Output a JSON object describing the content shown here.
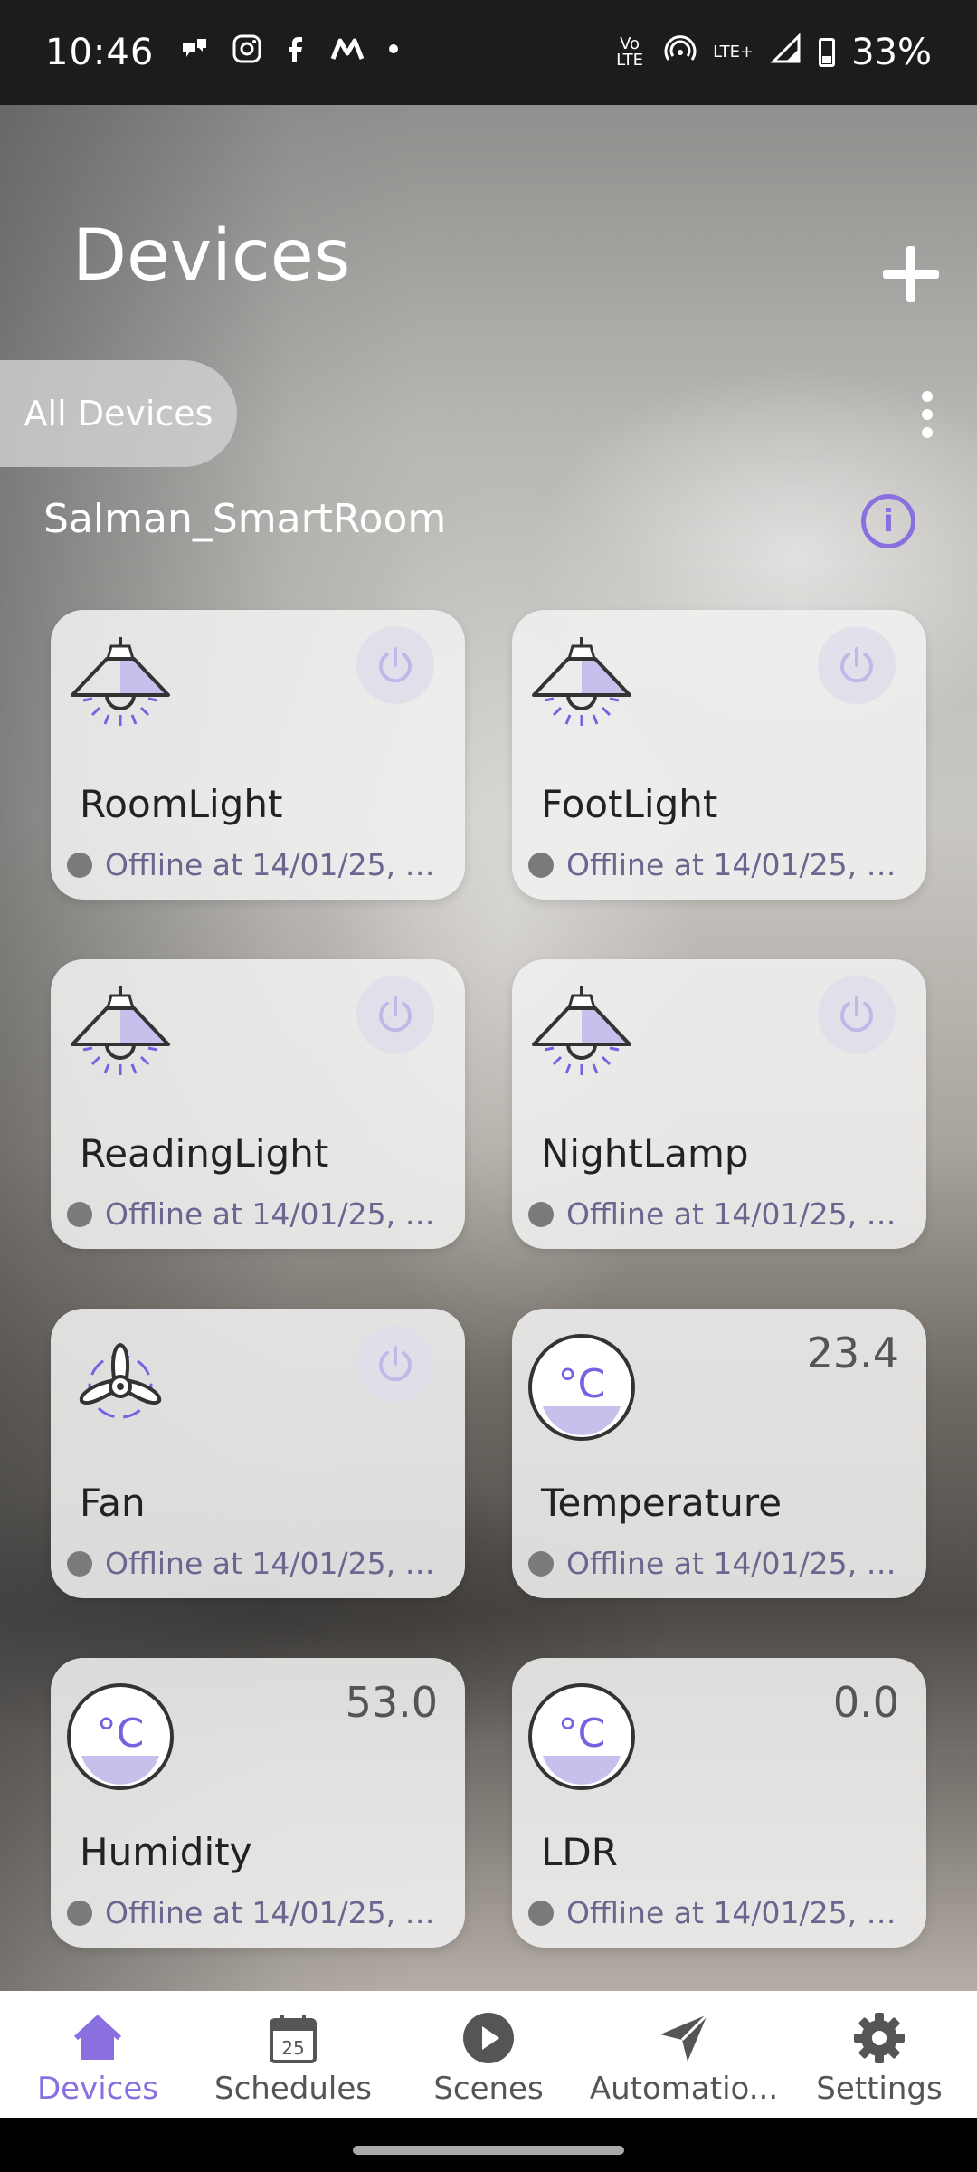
{
  "status_bar": {
    "time": "10:46",
    "volte": "Vo LTE",
    "lte": "LTE+",
    "battery": "33%"
  },
  "header": {
    "title": "Devices",
    "add_icon": "plus-icon",
    "menu_icon": "more-vertical-icon"
  },
  "filter": {
    "chip_label": "All Devices"
  },
  "room": {
    "name": "Salman_SmartRoom",
    "info_icon": "info-icon"
  },
  "devices": [
    {
      "name": "RoomLight",
      "icon": "ceiling-lamp-icon",
      "status": "Offline at 14/01/25, 01..."
    },
    {
      "name": "FootLight",
      "icon": "ceiling-lamp-icon",
      "status": "Offline at 14/01/25, 01..."
    },
    {
      "name": "ReadingLight",
      "icon": "ceiling-lamp-icon",
      "status": "Offline at 14/01/25, 01..."
    },
    {
      "name": "NightLamp",
      "icon": "ceiling-lamp-icon",
      "status": "Offline at 14/01/25, 01..."
    },
    {
      "name": "Fan",
      "icon": "fan-icon",
      "status": "Offline at 14/01/25, 01..."
    },
    {
      "name": "Temperature",
      "icon": "thermometer-celsius-icon",
      "reading": "23.4",
      "status": "Offline at 14/01/25, 01..."
    },
    {
      "name": "Humidity",
      "icon": "thermometer-celsius-icon",
      "reading": "53.0",
      "status": "Offline at 14/01/25, 01..."
    },
    {
      "name": "LDR",
      "icon": "thermometer-celsius-icon",
      "reading": "0.0",
      "status": "Offline at 14/01/25, 01..."
    }
  ],
  "nav": [
    {
      "label": "Devices",
      "icon": "home-icon",
      "active": true
    },
    {
      "label": "Schedules",
      "icon": "calendar-icon",
      "calendar_day": "25"
    },
    {
      "label": "Scenes",
      "icon": "play-icon"
    },
    {
      "label": "Automatio...",
      "icon": "send-icon"
    },
    {
      "label": "Settings",
      "icon": "gear-icon"
    }
  ],
  "colors": {
    "accent": "#8a6fe0",
    "offline_dot": "#7a7a7a"
  }
}
